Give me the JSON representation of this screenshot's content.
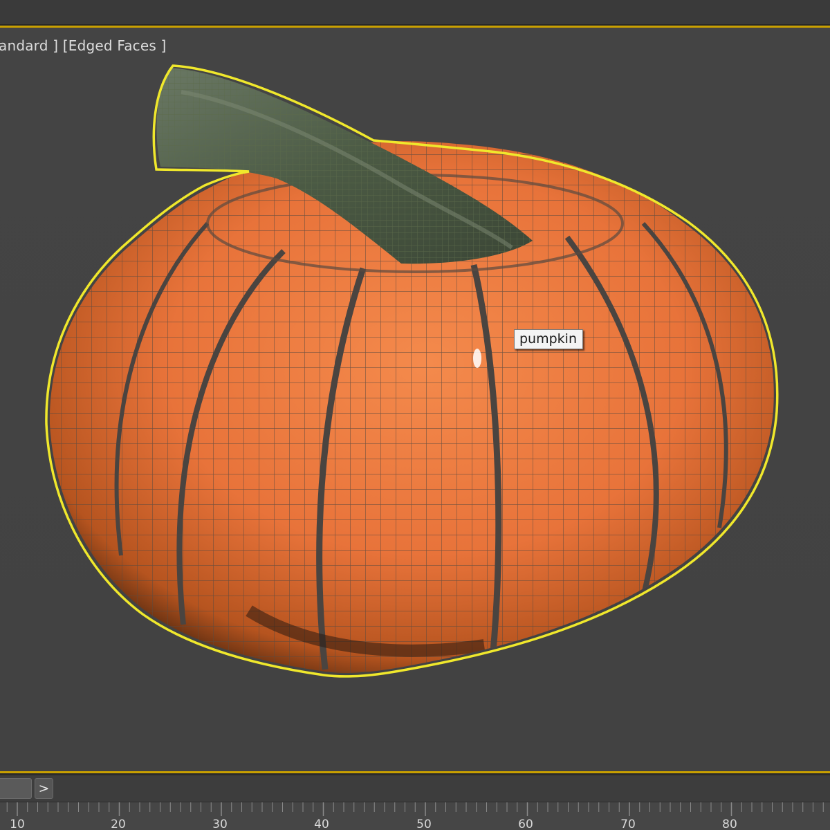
{
  "viewport": {
    "label": "andard ] [Edged Faces ]",
    "object_name": "pumpkin",
    "selection_color": "#f0e82c",
    "pumpkin_color": "#e8733a",
    "stem_color": "#4b5a44"
  },
  "timeline": {
    "next_frame_label": ">",
    "frame_labels": [
      "10",
      "20",
      "30",
      "40",
      "50",
      "60",
      "70",
      "80"
    ]
  }
}
